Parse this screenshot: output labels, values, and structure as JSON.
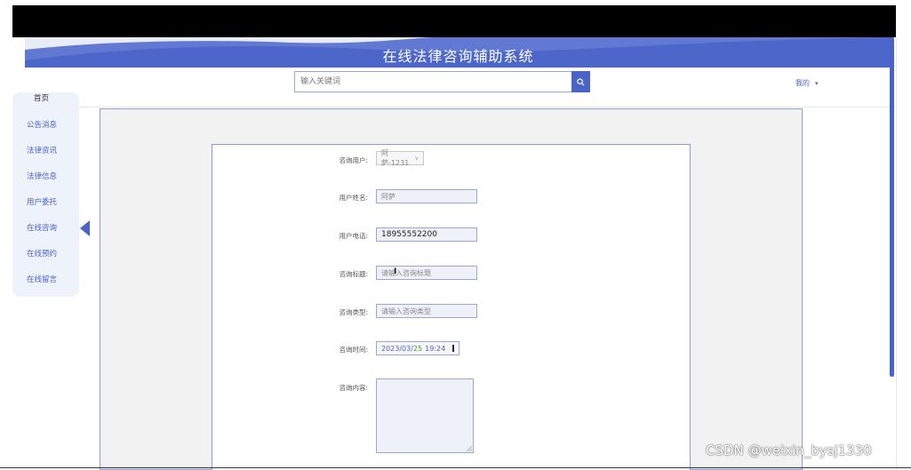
{
  "header": {
    "title": "在线法律咨询辅助系统",
    "search_placeholder": "输入关键词",
    "user_menu": "我的"
  },
  "sidebar": {
    "items": [
      {
        "label": "首页"
      },
      {
        "label": "公告消息"
      },
      {
        "label": "法律资讯"
      },
      {
        "label": "法律信息"
      },
      {
        "label": "用户委托"
      },
      {
        "label": "在线咨询"
      },
      {
        "label": "在线预约"
      },
      {
        "label": "在线留言"
      }
    ],
    "active_index": 5
  },
  "form": {
    "fields": [
      {
        "label": "咨询用户:",
        "value": "阿萨-1231"
      },
      {
        "label": "用户姓名:",
        "value": "阿萨"
      },
      {
        "label": "用户电话:",
        "value": "18955552200"
      },
      {
        "label": "咨询标题:",
        "placeholder": "请输入咨询标题"
      },
      {
        "label": "咨询类型:",
        "placeholder": "请输入咨询类型"
      },
      {
        "label": "咨询时间:",
        "date": "2023/03/",
        "day": "25",
        "time": "19:24"
      },
      {
        "label": "咨询内容:",
        "value": ""
      }
    ]
  },
  "watermark": "CSDN @weixin_bysj1330",
  "colors": {
    "accent": "#4a63c8",
    "panel_bg": "#f2f2f2",
    "sidebar_bg": "#eef2fb"
  },
  "icons": {
    "search": "search-icon",
    "calendar": "calendar-icon",
    "chevron": "chevron-down-icon"
  }
}
